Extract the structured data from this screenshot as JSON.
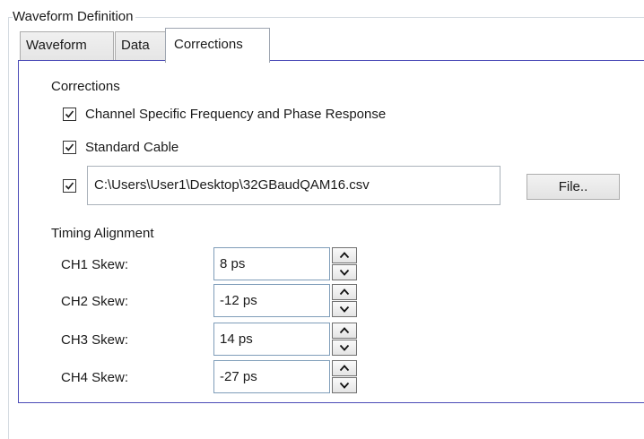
{
  "outer_group": {
    "title": "Waveform Definition"
  },
  "tabs": [
    {
      "label": "Waveform"
    },
    {
      "label": "Data"
    },
    {
      "label": "Corrections"
    }
  ],
  "corrections": {
    "title": "Corrections",
    "items": [
      {
        "label": "Channel Specific Frequency and Phase Response",
        "checked": true
      },
      {
        "label": "Standard Cable",
        "checked": true
      }
    ],
    "file": {
      "checked": true,
      "path": "C:\\Users\\User1\\Desktop\\32GBaudQAM16.csv",
      "button_label": "File.."
    }
  },
  "timing": {
    "title": "Timing Alignment",
    "rows": [
      {
        "label": "CH1 Skew:",
        "value": "8 ps"
      },
      {
        "label": "CH2 Skew:",
        "value": "-12 ps"
      },
      {
        "label": "CH3 Skew:",
        "value": "14 ps"
      },
      {
        "label": "CH4 Skew:",
        "value": "-27 ps"
      }
    ]
  },
  "icons": {
    "checkmark": "checkmark-icon",
    "spin_up": "chevron-up-icon",
    "spin_down": "chevron-down-icon"
  },
  "colors": {
    "panel_border": "#4b4bb7",
    "group_border": "#dce1e6",
    "input_border": "#7f9db9"
  }
}
